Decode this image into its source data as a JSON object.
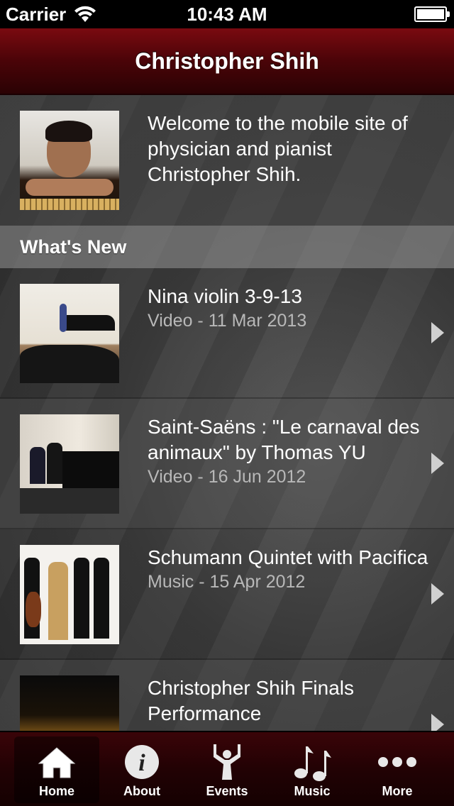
{
  "status_bar": {
    "carrier": "Carrier",
    "time": "10:43 AM"
  },
  "nav": {
    "title": "Christopher Shih"
  },
  "welcome": {
    "text": "Welcome to the mobile site of physician and pianist Christopher Shih."
  },
  "section": {
    "title": "What's New"
  },
  "items": [
    {
      "title": "Nina violin 3-9-13",
      "meta": "Video - 11 Mar 2013"
    },
    {
      "title": "Saint-Saëns : \"Le carnaval des animaux\" by Thomas YU",
      "meta": "Video - 16 Jun 2012"
    },
    {
      "title": "Schumann Quintet with Pacifica",
      "meta": "Music - 15 Apr 2012"
    },
    {
      "title": "Christopher Shih Finals Performance",
      "meta": ""
    }
  ],
  "tabs": [
    {
      "label": "Home",
      "icon": "home-icon",
      "active": true
    },
    {
      "label": "About",
      "icon": "info-icon",
      "active": false
    },
    {
      "label": "Events",
      "icon": "events-icon",
      "active": false
    },
    {
      "label": "Music",
      "icon": "music-icon",
      "active": false
    },
    {
      "label": "More",
      "icon": "more-icon",
      "active": false
    }
  ],
  "colors": {
    "nav_bar": "#4a0408",
    "tab_bar": "#220204",
    "meta_text": "#b8b8b8"
  }
}
